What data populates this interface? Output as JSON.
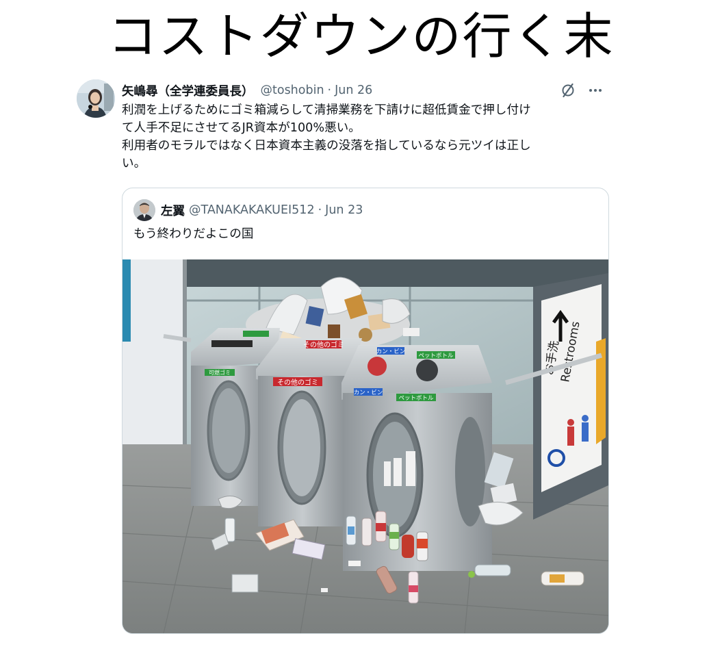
{
  "meme_title": "コストダウンの行く末",
  "tweet": {
    "display_name": "矢嶋尋（全学連委員長）",
    "handle": "@toshobin",
    "separator": "·",
    "date": "Jun 26",
    "icons": [
      "grok-icon",
      "more-icon"
    ],
    "text_lines": [
      "利潤を上げるためにゴミ箱減らして清掃業務を下請けに超低賃金で押し付け",
      "て人手不足にさせてるJR資本が100%悪い。",
      "利用者のモラルではなく日本資本主義の没落を指しているなら元ツイは正し",
      "い。"
    ]
  },
  "quote": {
    "display_name": "左翼",
    "handle": "@TANAKAKAKUEI512",
    "separator": "·",
    "date": "Jun 23",
    "text": "もう終わりだよこの国",
    "photo": {
      "sign_labels": {
        "restroom_en": "Restrooms",
        "restroom_jp": "お手洗",
        "bin_burnable": "可燃ゴミ",
        "bin_other": "その他のゴミ",
        "bin_other_label": "その他のゴミ",
        "bin_cans": "カン・ビン",
        "bin_pet": "ペットボトル"
      }
    }
  },
  "colors": {
    "text_primary": "#0f1419",
    "text_secondary": "#536471",
    "border": "#cfd9de",
    "bin_steel": "#b7bcbf",
    "label_green": "#2e9a3f",
    "label_red": "#c8282e",
    "label_blue": "#2a63c8"
  }
}
